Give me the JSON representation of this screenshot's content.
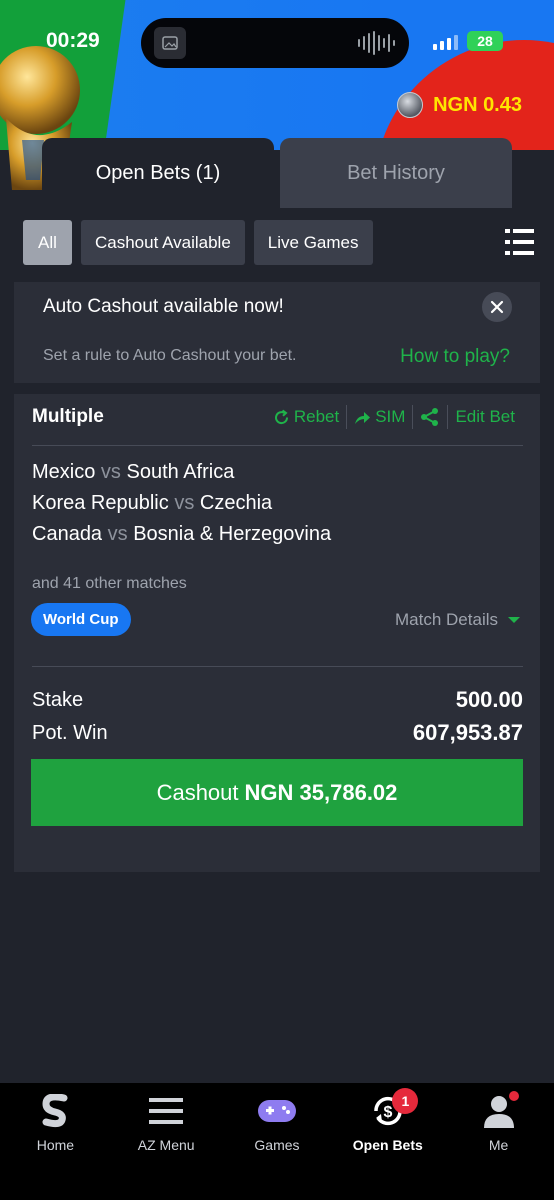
{
  "status": {
    "time": "00:29",
    "battery": "28"
  },
  "account": {
    "balance": "NGN 0.43"
  },
  "tabs": [
    {
      "label": "Open Bets (1)",
      "active": true
    },
    {
      "label": "Bet History",
      "active": false
    }
  ],
  "filters": [
    "All",
    "Cashout Available",
    "Live Games"
  ],
  "notice": {
    "title": "Auto Cashout available now!",
    "text": "Set a rule to Auto Cashout your bet.",
    "link": "How to play?"
  },
  "bet": {
    "type": "Multiple",
    "actions": {
      "rebet": "Rebet",
      "sim": "SIM",
      "edit": "Edit Bet"
    },
    "matches": [
      {
        "home": "Mexico",
        "vs": "vs",
        "away": "South Africa"
      },
      {
        "home": "Korea Republic",
        "vs": "vs",
        "away": "Czechia"
      },
      {
        "home": "Canada",
        "vs": "vs",
        "away": "Bosnia & Herzegovina"
      }
    ],
    "others": "and 41 other matches",
    "tag": "World Cup",
    "details": "Match Details",
    "stake_label": "Stake",
    "stake": "500.00",
    "potwin_label": "Pot. Win",
    "potwin": "607,953.87",
    "cashout_label": "Cashout",
    "cashout_amount": "NGN 35,786.02"
  },
  "nav": [
    {
      "label": "Home",
      "icon": "sporty-logo-icon"
    },
    {
      "label": "AZ Menu",
      "icon": "menu-icon"
    },
    {
      "label": "Games",
      "icon": "gamepad-icon"
    },
    {
      "label": "Open Bets",
      "icon": "cashout-icon",
      "badge": "1",
      "selected": true
    },
    {
      "label": "Me",
      "icon": "user-icon"
    }
  ],
  "colors": {
    "accent": "#1fb34a",
    "primary": "#1877f2",
    "balance": "#ffe600",
    "badge": "#e5293b"
  }
}
